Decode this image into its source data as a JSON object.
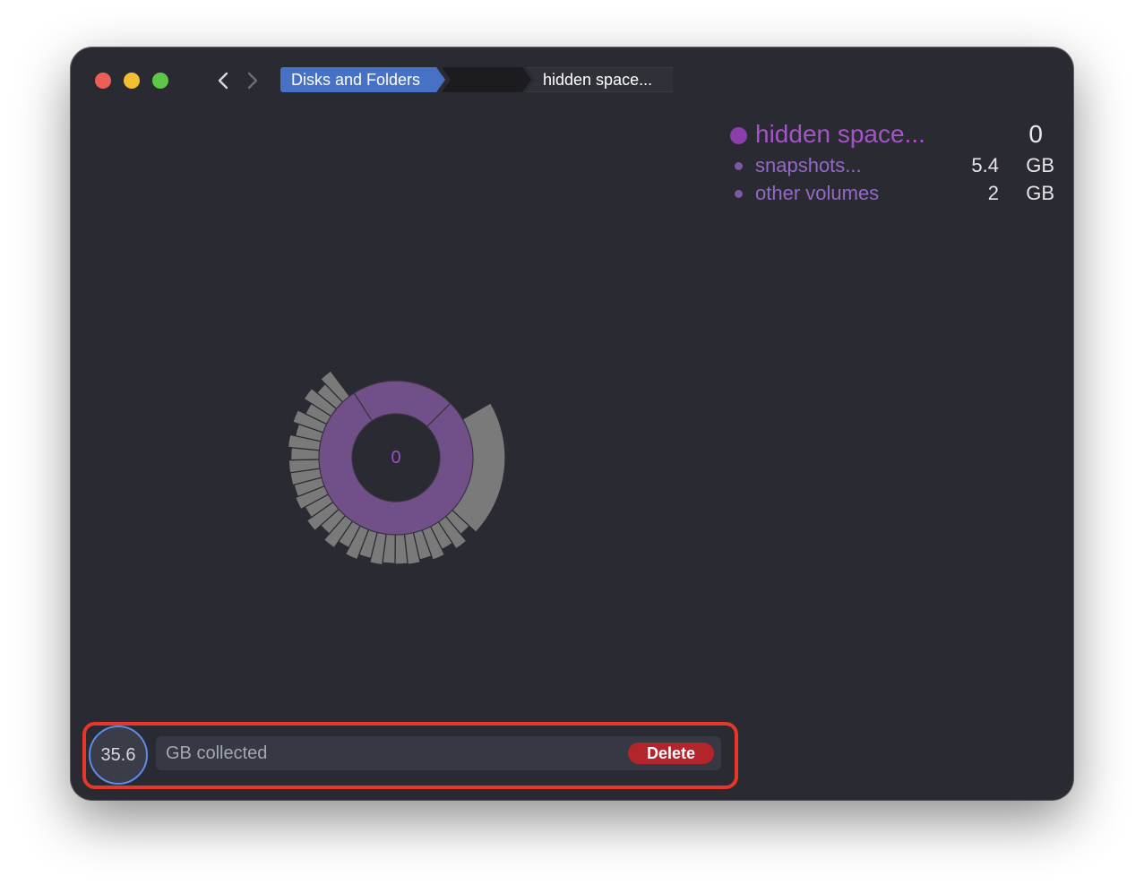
{
  "toolbar": {
    "back_icon": "chevron-left-icon",
    "forward_icon": "chevron-right-icon",
    "breadcrumbs": [
      {
        "label": "Disks and Folders"
      },
      {
        "label": ""
      },
      {
        "label": "hidden space..."
      }
    ]
  },
  "legend": {
    "title": "hidden space...",
    "title_value": "0",
    "items": [
      {
        "label": "snapshots...",
        "value": "5.4",
        "unit": "GB"
      },
      {
        "label": "other volumes",
        "value": "2",
        "unit": "GB"
      }
    ]
  },
  "chart": {
    "center_label": "0"
  },
  "collector": {
    "amount": "35.6",
    "label": "GB collected",
    "delete_label": "Delete"
  },
  "colors": {
    "window_bg": "#2a2b32",
    "accent_purple": "#8c3fab",
    "ring_purple": "#714f88",
    "segment_gray": "#7a7a7a",
    "breadcrumb_blue": "#4671c4",
    "delete_red": "#b3242b",
    "highlight_red": "#e8362a"
  }
}
